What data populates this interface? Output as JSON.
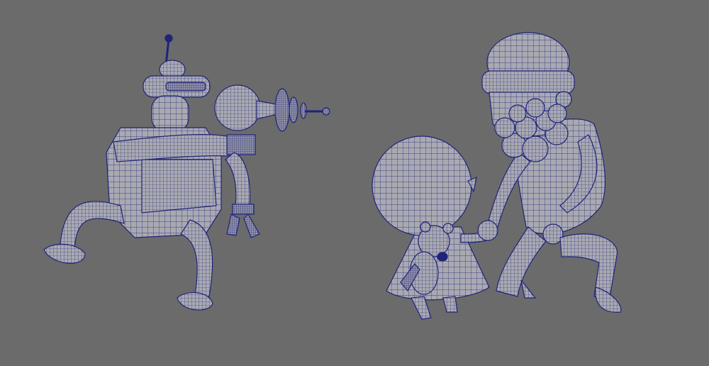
{
  "scene": {
    "background_color": "#6b6b6b",
    "mesh_fill_color": "#a9a9b1",
    "wire_color": "#1f237a",
    "objects": [
      "robot-with-raygun",
      "child-with-teddy-bear",
      "bearded-man-with-beanie"
    ]
  }
}
